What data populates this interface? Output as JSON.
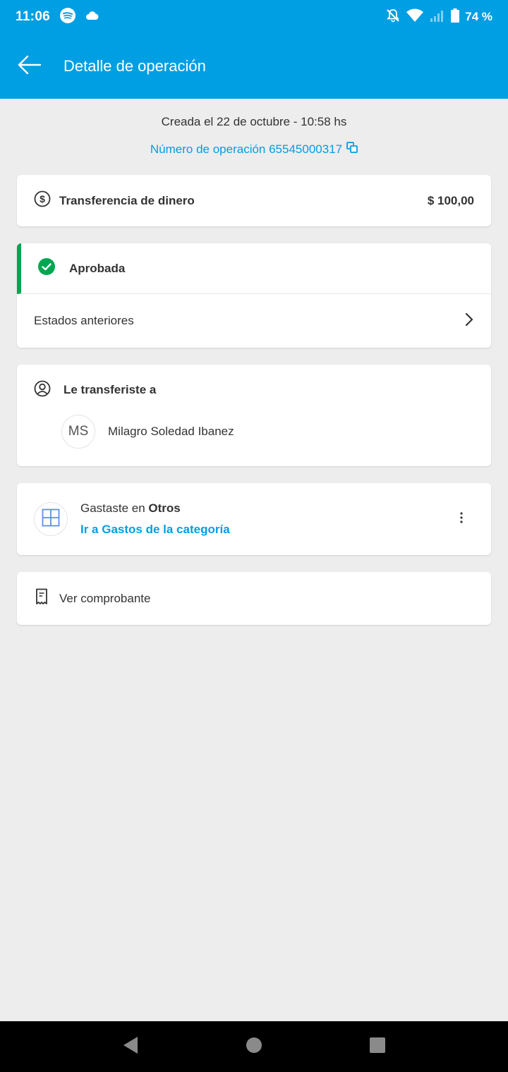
{
  "status_bar": {
    "time": "11:06",
    "battery": "74 %",
    "icons": [
      "spotify-icon",
      "cloud-icon",
      "notifications-off-icon",
      "wifi-icon",
      "signal-icon",
      "battery-icon"
    ]
  },
  "app_bar": {
    "title": "Detalle de operación",
    "back_icon": "arrow-back-icon"
  },
  "operation": {
    "created": "Creada el 22 de octubre - 10:58 hs",
    "number_label": "Número de operación 65545000317"
  },
  "transfer": {
    "label": "Transferencia de dinero",
    "amount": "$ 100,00"
  },
  "status": {
    "label": "Aprobada",
    "previous_label": "Estados anteriores",
    "color": "#00a650"
  },
  "recipient": {
    "header": "Le transferiste a",
    "initials": "MS",
    "name": "Milagro Soledad Ibanez"
  },
  "category": {
    "prefix": "Gastaste en ",
    "name": "Otros",
    "link": "Ir a Gastos de la categoría"
  },
  "receipt": {
    "label": "Ver comprobante"
  },
  "colors": {
    "accent": "#009ee3",
    "approved": "#00a650",
    "background": "#ededed"
  }
}
